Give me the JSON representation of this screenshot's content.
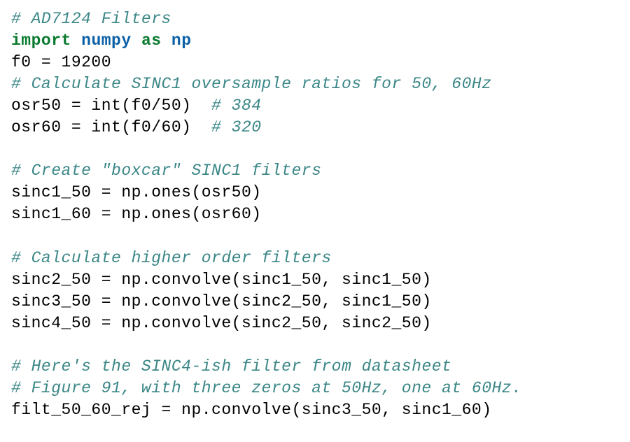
{
  "code": {
    "line1_comment": "# AD7124 Filters",
    "line2_import": "import",
    "line2_numpy": "numpy",
    "line2_as": "as",
    "line2_np": "np",
    "line3": "f0 = 19200",
    "line4_comment": "# Calculate SINC1 oversample ratios for 50, 60Hz",
    "line5_code": "osr50 = int(f0/50)  ",
    "line5_comment": "# 384",
    "line6_code": "osr60 = int(f0/60)  ",
    "line6_comment": "# 320",
    "line8_comment": "# Create \"boxcar\" SINC1 filters",
    "line9": "sinc1_50 = np.ones(osr50)",
    "line10": "sinc1_60 = np.ones(osr60)",
    "line12_comment": "# Calculate higher order filters",
    "line13": "sinc2_50 = np.convolve(sinc1_50, sinc1_50)",
    "line14": "sinc3_50 = np.convolve(sinc2_50, sinc1_50)",
    "line15": "sinc4_50 = np.convolve(sinc2_50, sinc2_50)",
    "line17_comment": "# Here's the SINC4-ish filter from datasheet",
    "line18_comment": "# Figure 91, with three zeros at 50Hz, one at 60Hz.",
    "line19": "filt_50_60_rej = np.convolve(sinc3_50, sinc1_60)"
  }
}
